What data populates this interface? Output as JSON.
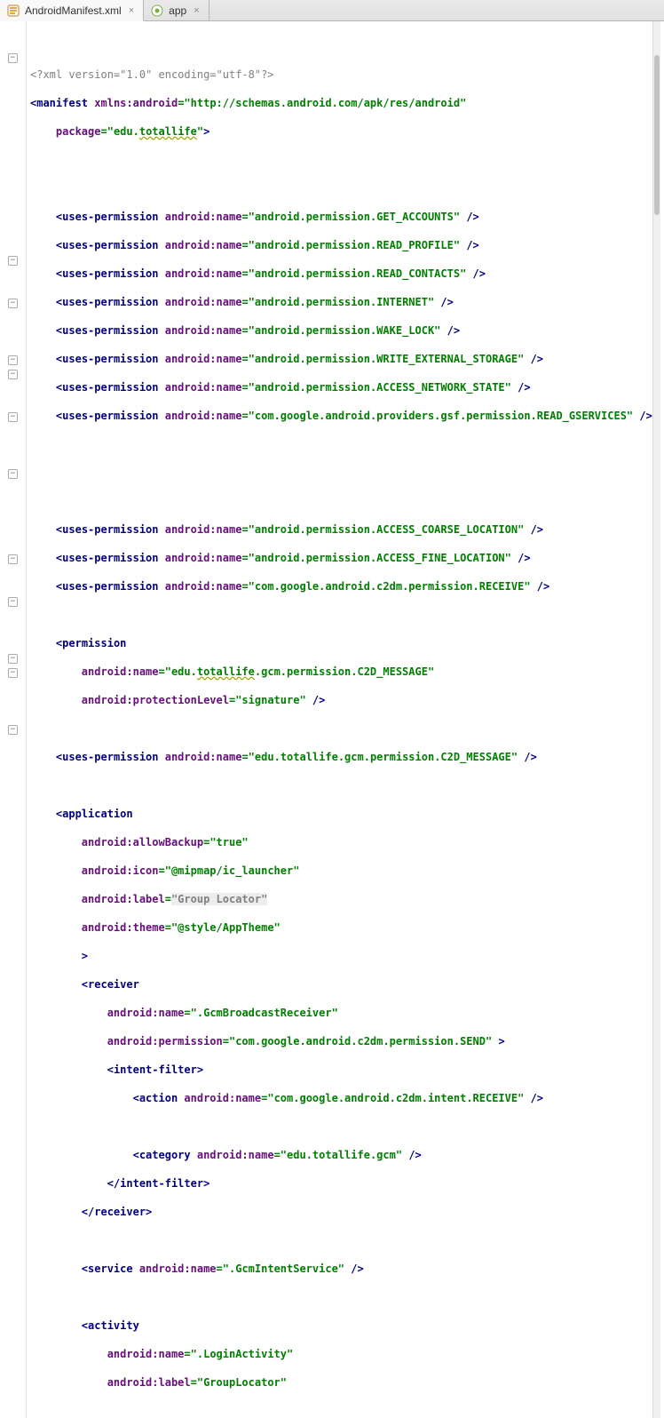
{
  "tabs": {
    "t1": {
      "label": "AndroidManifest.xml"
    },
    "t2": {
      "label": "app"
    }
  },
  "xml": {
    "decl_full": "<?xml version=\"1.0\" encoding=\"utf-8\"?>",
    "manifest": {
      "xmlns_attr": "xmlns:android",
      "xmlns_val": "\"http://schemas.android.com/apk/res/android\"",
      "pkg_attr": "package",
      "pkg_val_l": "\"edu.",
      "pkg_val_squig": "totallife",
      "pkg_val_r": "\""
    },
    "perm_attr": "android:name",
    "perms": {
      "p1": "\"android.permission.GET_ACCOUNTS\"",
      "p2": "\"android.permission.READ_PROFILE\"",
      "p3": "\"android.permission.READ_CONTACTS\"",
      "p4": "\"android.permission.INTERNET\"",
      "p5": "\"android.permission.WAKE_LOCK\"",
      "p6": "\"android.permission.WRITE_EXTERNAL_STORAGE\"",
      "p7": "\"android.permission.ACCESS_NETWORK_STATE\"",
      "p8": "\"com.google.android.providers.gsf.permission.READ_GSERVICES\"",
      "p9": "\"android.permission.ACCESS_COARSE_LOCATION\"",
      "p10": "\"android.permission.ACCESS_FINE_LOCATION\"",
      "p11": "\"com.google.android.c2dm.permission.RECEIVE\"",
      "p12": "\"edu.totallife.gcm.permission.C2D_MESSAGE\""
    },
    "permission": {
      "name_l": "\"edu.",
      "name_squig": "totallife",
      "name_r": ".gcm.permission.C2D_MESSAGE\"",
      "level_attr": "android:protectionLevel",
      "level_val": "\"signature\""
    },
    "app": {
      "backup_attr": "android:allowBackup",
      "backup_val": "\"true\"",
      "icon_attr": "android:icon",
      "icon_val": "\"@mipmap/ic_launcher\"",
      "label_attr": "android:label",
      "label_val": "\"Group Locator\"",
      "theme_attr": "android:theme",
      "theme_val": "\"@style/AppTheme\""
    },
    "receiver": {
      "name_attr": "android:name",
      "name_val": "\".GcmBroadcastReceiver\"",
      "perm_attr": "android:permission",
      "perm_val": "\"com.google.android.c2dm.permission.SEND\"",
      "action_val": "\"com.google.android.c2dm.intent.RECEIVE\"",
      "category_val": "\"edu.totallife.gcm\""
    },
    "service": {
      "name_val": "\".GcmIntentService\""
    },
    "activity": {
      "name_val": "\".LoginActivity\"",
      "label_val": "\"GroupLocator\""
    }
  }
}
